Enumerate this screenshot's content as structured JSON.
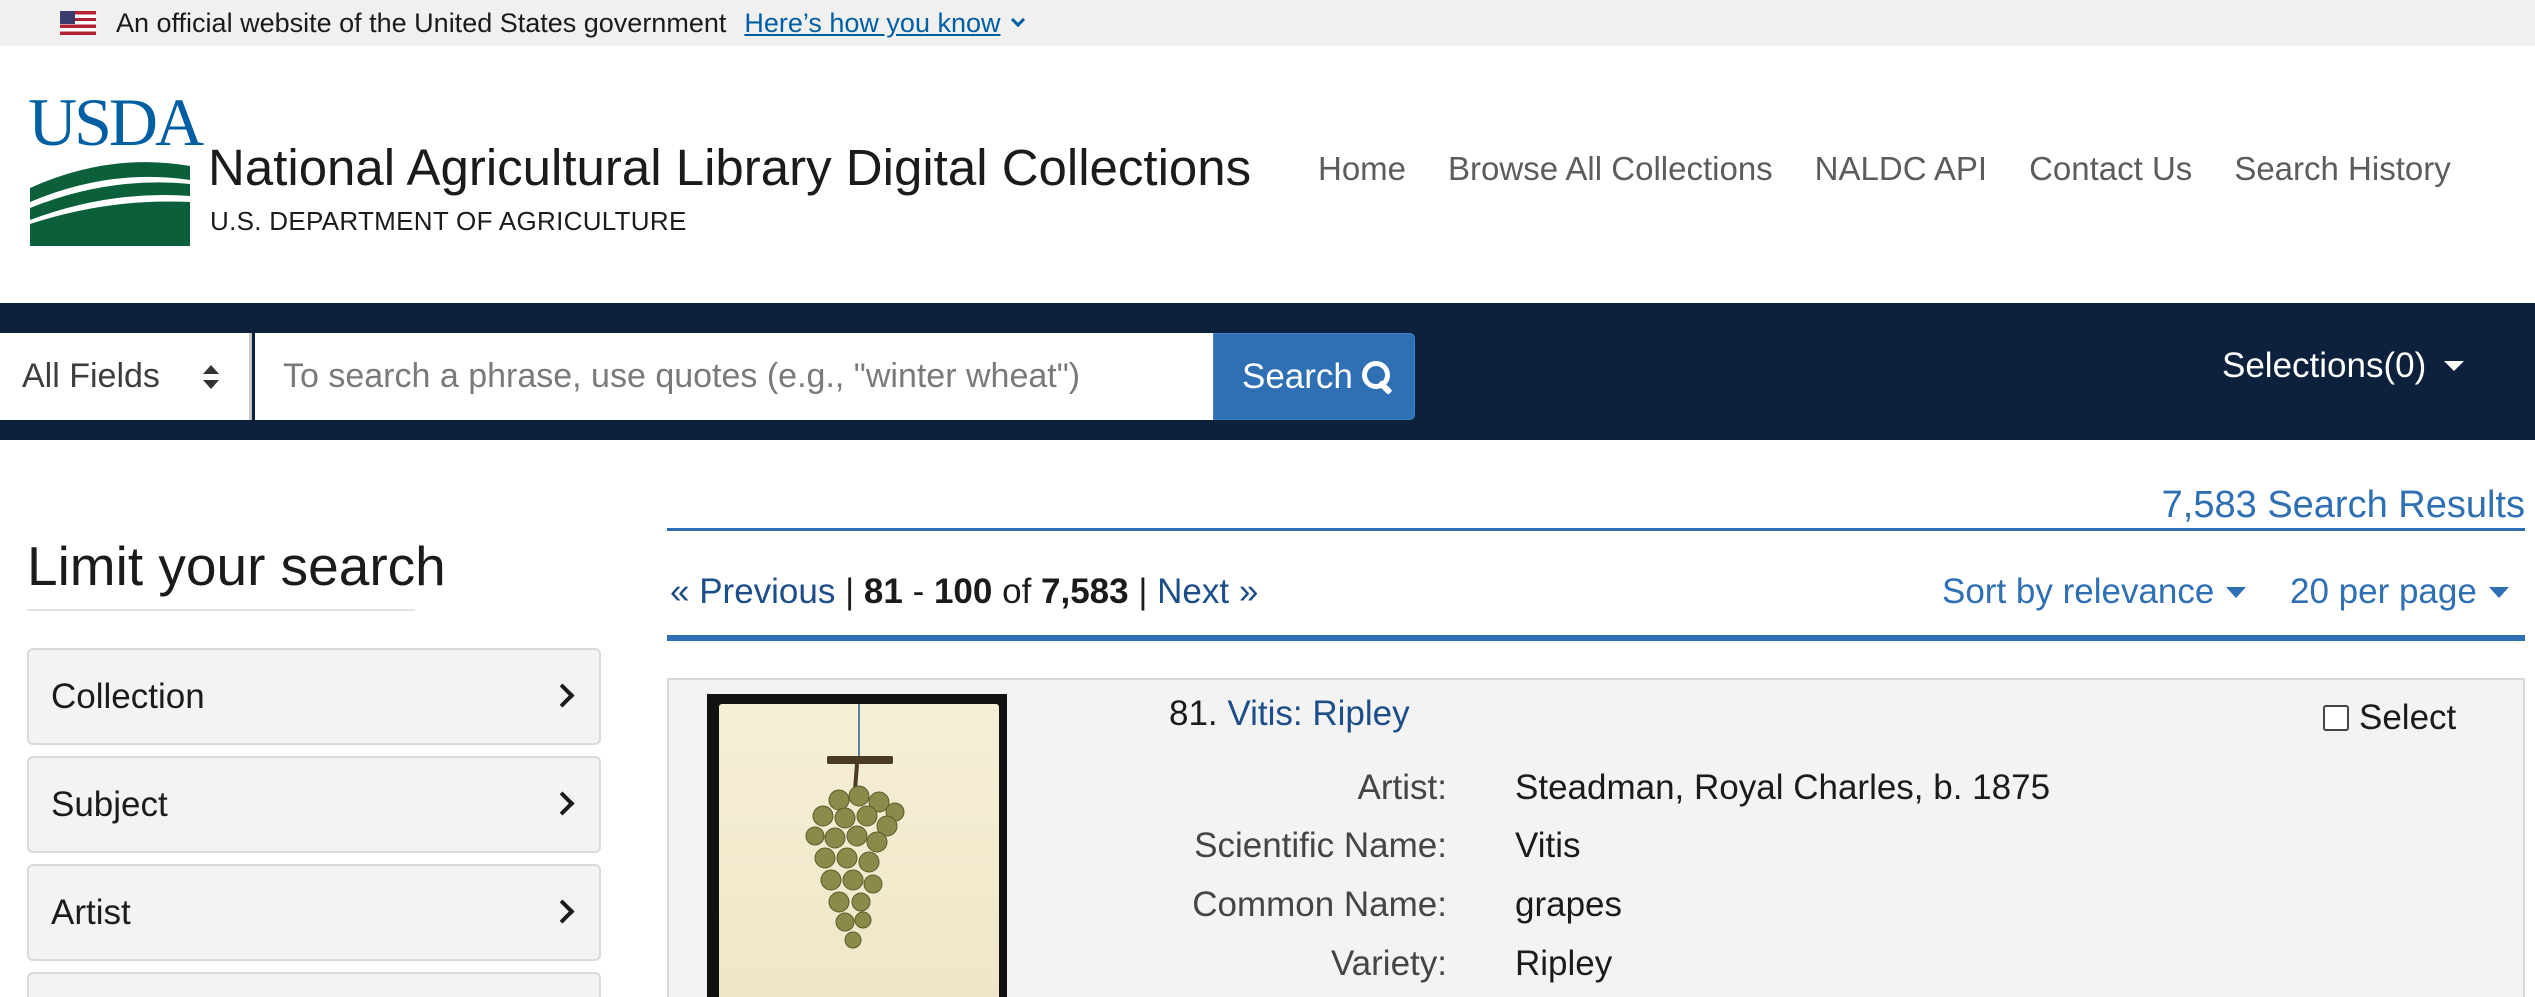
{
  "gov_banner": {
    "text": "An official website of the United States government",
    "link": "Here’s how you know"
  },
  "header": {
    "logo_text": "USDA",
    "title": "National Agricultural Library Digital Collections",
    "subtitle": "U.S. DEPARTMENT OF AGRICULTURE",
    "nav": [
      "Home",
      "Browse All Collections",
      "NALDC API",
      "Contact Us",
      "Search History"
    ]
  },
  "search": {
    "field_selected": "All Fields",
    "placeholder": "To search a phrase, use quotes (e.g., \"winter wheat\")",
    "button_label": "Search",
    "selections_label": "Selections(0)"
  },
  "sidebar": {
    "title": "Limit your search",
    "facets": [
      "Collection",
      "Subject",
      "Artist"
    ]
  },
  "results": {
    "count_label": "7,583  Search Results",
    "pager": {
      "previous": "« Previous",
      "sep1": " | ",
      "start": "81",
      "dash": " - ",
      "end": "100",
      "of": " of ",
      "total": "7,583",
      "sep2": " | ",
      "next": "Next »"
    },
    "sort_label": "Sort by relevance",
    "per_page_label": "20 per page",
    "items": [
      {
        "number": "81.",
        "title": "Vitis: Ripley",
        "select_label": "Select",
        "fields": [
          {
            "label": "Artist:",
            "value": "Steadman, Royal Charles, b. 1875"
          },
          {
            "label": "Scientific Name:",
            "value": "Vitis"
          },
          {
            "label": "Common Name:",
            "value": "grapes"
          },
          {
            "label": "Variety:",
            "value": "Ripley"
          }
        ]
      }
    ]
  },
  "colors": {
    "navy_bar": "#0d213c",
    "link_blue": "#2f6fb3",
    "usda_blue": "#005ea2",
    "usda_green": "#0b5f3a"
  }
}
